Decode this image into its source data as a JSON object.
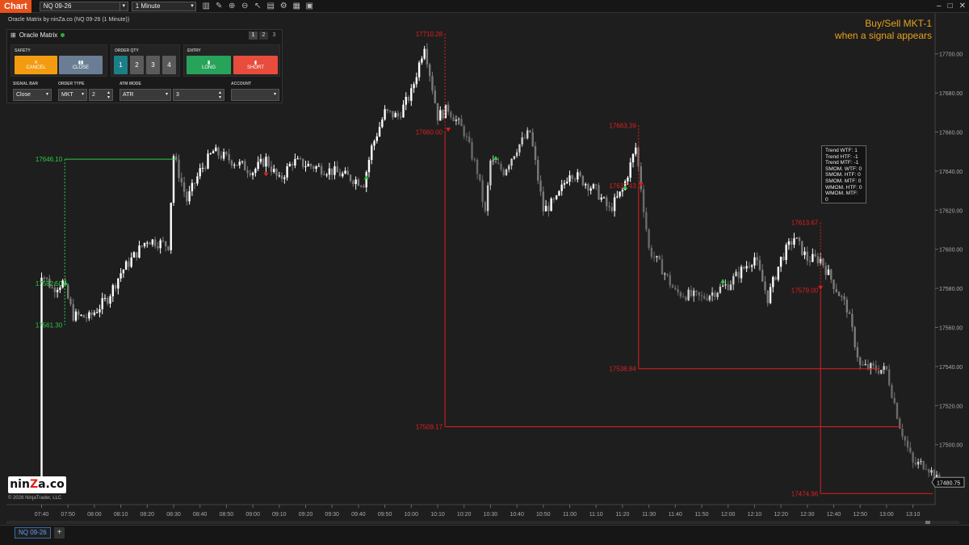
{
  "topbar": {
    "chart_tab": "Chart",
    "instrument": "NQ 09-26",
    "period": "1 Minute",
    "window_controls": [
      "–",
      "□",
      "✕"
    ]
  },
  "chart_title": "Oracle Matrix by ninZa.co (NQ 09-26 (1 Minute))",
  "oracle_matrix": {
    "title": "Oracle Matrix",
    "pages": [
      "1",
      "2",
      "3"
    ],
    "safety": {
      "label": "SAFETY",
      "cancel": "CANCEL",
      "close": "CLOSE"
    },
    "order_qty": {
      "label": "ORDER QTY",
      "options": [
        "1",
        "2",
        "3",
        "4"
      ]
    },
    "entry": {
      "label": "ENTRY",
      "long": "LONG",
      "short": "SHORT"
    },
    "signal_bar": {
      "label": "SIGNAL BAR",
      "value": "Close"
    },
    "order_type": {
      "label": "ORDER TYPE",
      "value": "MKT",
      "qty": "2"
    },
    "atm_mode": {
      "label": "ATM MODE",
      "value": "ATR",
      "qty": "3"
    },
    "account": {
      "label": "ACCOUNT",
      "value": ""
    }
  },
  "instructions": {
    "line1": "Buy/Sell MKT-1",
    "line2": "when a signal appears"
  },
  "tooltip": [
    "Trend WTF: 1",
    "Trend HTF: -1",
    "Trend MTF: -1",
    "SMOM. WTF: 0",
    "SMOM. HTF: 0",
    "SMOM. MTF: 0",
    "WMOM. HTF: 0",
    "WMOM. MTF: 0"
  ],
  "price_axis": {
    "labels": [
      "17700.00",
      "17680.00",
      "17660.00",
      "17640.00",
      "17620.00",
      "17600.00",
      "17580.00",
      "17560.00",
      "17540.00",
      "17520.00",
      "17500.00"
    ],
    "current": "17480.75"
  },
  "time_axis": [
    "07:40",
    "07:50",
    "08:00",
    "08:10",
    "08:20",
    "08:30",
    "08:40",
    "08:50",
    "09:00",
    "09:10",
    "09:20",
    "09:30",
    "09:40",
    "09:50",
    "10:00",
    "10:10",
    "10:20",
    "10:30",
    "10:40",
    "10:50",
    "11:00",
    "11:10",
    "11:20",
    "11:30",
    "11:40",
    "11:50",
    "12:00",
    "12:10",
    "12:20",
    "12:30",
    "12:40",
    "12:50",
    "13:00",
    "13:10"
  ],
  "levels": {
    "long1": {
      "high": "17646.10",
      "entry": "17582.50",
      "low": "17561.30"
    },
    "short1": {
      "high": "17710.28",
      "entry": "17660.00",
      "target": "17509.17"
    },
    "short2": {
      "high": "17663.39",
      "entry": "17632.43",
      "target": "17538.84"
    },
    "short3": {
      "high": "17613.67",
      "entry": "17579.00",
      "target": "17474.96"
    }
  },
  "colors": {
    "long": "#2ecc40",
    "short": "#e01f1f",
    "accent": "#e8501c",
    "instructions": "#e8a21a"
  },
  "logo": {
    "text_a": "nin",
    "text_b": "Z",
    "text_c": "a.co"
  },
  "copyright": "© 2026 NinjaTrader, LLC",
  "bottom_tab": "NQ 09-26",
  "icons": [
    "bar-chart-icon",
    "pencil-icon",
    "zoom-in-icon",
    "zoom-out-icon",
    "pointer-icon",
    "properties-icon",
    "strategies-icon",
    "templates-icon",
    "snapshot-icon"
  ]
}
